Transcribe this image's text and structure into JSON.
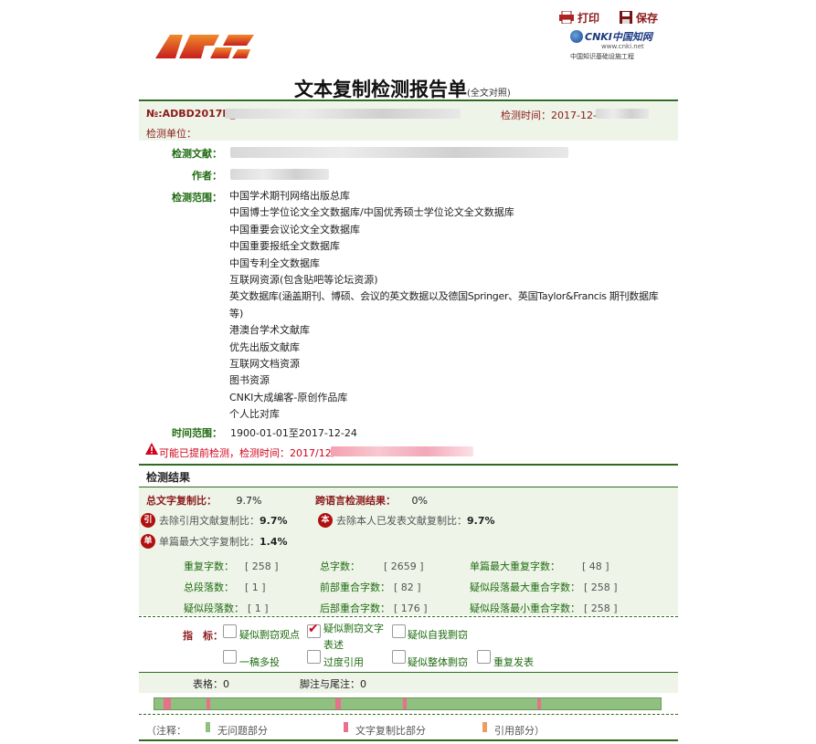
{
  "header": {
    "print_label": "打印",
    "save_label": "保存",
    "cnki_logo_text": "CNKI中国知网",
    "cnki_url": "www.cnki.net",
    "cnki_subtitle": "中国知识基础设施工程"
  },
  "title": {
    "main": "文本复制检测报告单",
    "sub": "(全文对照)"
  },
  "info": {
    "no_label": "№:ADBD2017R_",
    "time_label": "检测时间：2017-12-",
    "unit_label": "检测单位："
  },
  "details": {
    "doc_label": "检测文献：",
    "author_label": "作者：",
    "scope_label": "检测范围：",
    "scope_items": [
      "中国学术期刊网络出版总库",
      "中国博士学位论文全文数据库/中国优秀硕士学位论文全文数据库",
      "中国重要会议论文全文数据库",
      "中国重要报纸全文数据库",
      "中国专利全文数据库",
      "互联网资源(包含贴吧等论坛资源)",
      "英文数据库(涵盖期刊、博硕、会议的英文数据以及德国Springer、英国Taylor&Francis 期刊数据库",
      "等)",
      "港澳台学术文献库",
      "优先出版文献库",
      "互联网文档资源",
      "图书资源",
      "CNKI大成编客-原创作品库",
      "个人比对库"
    ],
    "time_range_label": "时间范围：",
    "time_range_value": "1900-01-01至2017-12-24"
  },
  "warning": {
    "text": "可能已提前检测，检测时间：2017/12/"
  },
  "results": {
    "section_title": "检测结果",
    "total_copy_label": "总文字复制比：",
    "total_copy_value": "9.7%",
    "cross_lang_label": "跨语言检测结果：",
    "cross_lang_value": "0%",
    "exclude_ref_label": "去除引用文献复制比：",
    "exclude_ref_value": "9.7%",
    "exclude_self_label": "去除本人已发表文献复制比：",
    "exclude_self_value": "9.7%",
    "max_single_label": "单篇最大文字复制比：",
    "max_single_value": "1.4%",
    "badge_ref": "引",
    "badge_self": "本",
    "badge_single": "单",
    "stats": [
      {
        "label": "重复字数：",
        "value": "[ 258 ]"
      },
      {
        "label": "总字数：",
        "value": "[ 2659 ]"
      },
      {
        "label": "单篇最大重复字数：",
        "value": "[ 48 ]"
      },
      {
        "label": "总段落数：",
        "value": "[ 1 ]"
      },
      {
        "label": "前部重合字数：",
        "value": "[ 82 ]"
      },
      {
        "label": "疑似段落最大重合字数：",
        "value": "[ 258 ]"
      },
      {
        "label": "疑似段落数：",
        "value": "[ 1 ]"
      },
      {
        "label": "后部重合字数：",
        "value": "[ 176 ]"
      },
      {
        "label": "疑似段落最小重合字数：",
        "value": "[ 258 ]"
      }
    ]
  },
  "indicators": {
    "label": "指　标：",
    "items": [
      {
        "label": "疑似剽窃观点",
        "checked": false
      },
      {
        "label": "疑似剽窃文字",
        "label2": "表述",
        "checked": true
      },
      {
        "label": "疑似自我剽窃",
        "checked": false
      },
      {
        "label": "一稿多投",
        "checked": false
      },
      {
        "label": "过度引用",
        "checked": false
      },
      {
        "label": "疑似整体剽窃",
        "checked": false
      },
      {
        "label": "重复发表",
        "checked": false
      }
    ]
  },
  "tables": {
    "table_label": "表格：0",
    "footnote_label": "脚注与尾注：0"
  },
  "legend": {
    "prefix": "（注释：",
    "ok": "无问题部分",
    "copy": "文字复制比部分",
    "cite": "引用部分）"
  },
  "colors": {
    "green_bar": "#8fc07f",
    "copy_mark": "#e8708c",
    "cite_mark": "#e8a060",
    "label_green": "#1f6b10",
    "warn_red": "#d0021b"
  }
}
